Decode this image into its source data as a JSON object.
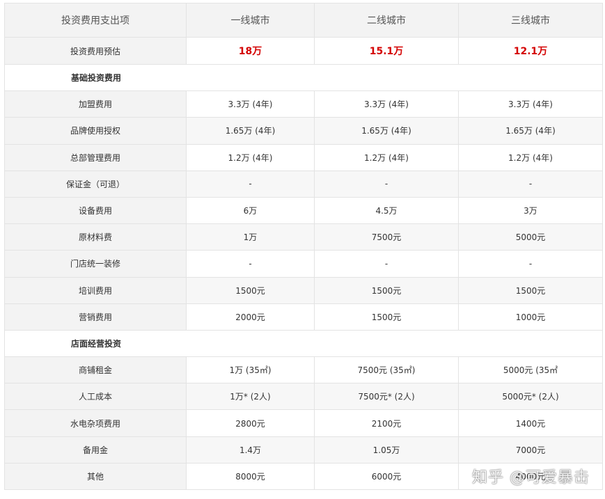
{
  "headers": [
    "投资费用支出项",
    "一线城市",
    "二线城市",
    "三线城市"
  ],
  "estimate": {
    "label": "投资费用预估",
    "values": [
      "18万",
      "15.1万",
      "12.1万"
    ]
  },
  "sections": [
    {
      "title": "基础投资费用",
      "rows": [
        {
          "label": "加盟费用",
          "values": [
            "3.3万 (4年)",
            "3.3万 (4年)",
            "3.3万 (4年)"
          ]
        },
        {
          "label": "品牌使用授权",
          "values": [
            "1.65万 (4年)",
            "1.65万 (4年)",
            "1.65万 (4年)"
          ]
        },
        {
          "label": "总部管理费用",
          "values": [
            "1.2万 (4年)",
            "1.2万 (4年)",
            "1.2万 (4年)"
          ]
        },
        {
          "label": "保证金（可退）",
          "values": [
            "-",
            "-",
            "-"
          ]
        },
        {
          "label": "设备费用",
          "values": [
            "6万",
            "4.5万",
            "3万"
          ]
        },
        {
          "label": "原材料费",
          "values": [
            "1万",
            "7500元",
            "5000元"
          ]
        },
        {
          "label": "门店统一装修",
          "values": [
            "-",
            "-",
            "-"
          ]
        },
        {
          "label": "培训费用",
          "values": [
            "1500元",
            "1500元",
            "1500元"
          ]
        },
        {
          "label": "营销费用",
          "values": [
            "2000元",
            "1500元",
            "1000元"
          ]
        }
      ]
    },
    {
      "title": "店面经营投资",
      "rows": [
        {
          "label": "商铺租金",
          "values": [
            "1万 (35㎡)",
            "7500元 (35㎡)",
            "5000元 (35㎡"
          ]
        },
        {
          "label": "人工成本",
          "values": [
            "1万* (2人)",
            "7500元* (2人)",
            "5000元* (2人)"
          ]
        },
        {
          "label": "水电杂项费用",
          "values": [
            "2800元",
            "2100元",
            "1400元"
          ]
        },
        {
          "label": "备用金",
          "values": [
            "1.4万",
            "1.05万",
            "7000元"
          ]
        },
        {
          "label": "其他",
          "values": [
            "8000元",
            "6000元",
            "4000元"
          ]
        }
      ]
    }
  ],
  "watermark": "知乎 @可爱暴击"
}
